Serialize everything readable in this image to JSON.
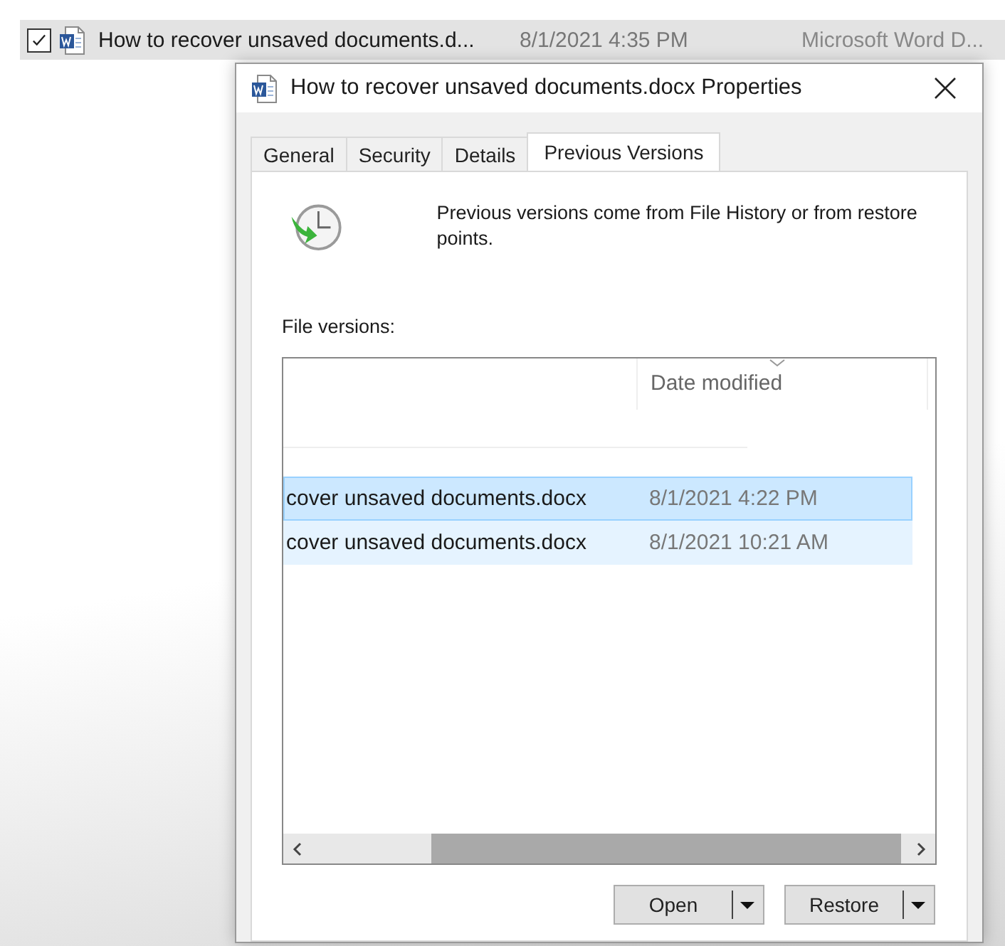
{
  "explorer_row": {
    "checked": true,
    "name": "How to recover unsaved documents.d...",
    "date": "8/1/2021 4:35 PM",
    "type": "Microsoft Word D..."
  },
  "dialog": {
    "title": "How to recover unsaved documents.docx Properties",
    "tabs": [
      {
        "label": "General",
        "selected": false
      },
      {
        "label": "Security",
        "selected": false
      },
      {
        "label": "Details",
        "selected": false
      },
      {
        "label": "Previous Versions",
        "selected": true
      }
    ],
    "description": "Previous versions come from File History or from restore points.",
    "versions_label": "File versions:",
    "columns": [
      {
        "label": "Date modified"
      }
    ],
    "rows": [
      {
        "name": "cover unsaved documents.docx",
        "date": "8/1/2021 4:22 PM",
        "selected": true,
        "hovered": false
      },
      {
        "name": "cover unsaved documents.docx",
        "date": "8/1/2021 10:21 AM",
        "selected": false,
        "hovered": true
      }
    ],
    "buttons": [
      {
        "label": "Open"
      },
      {
        "label": "Restore"
      }
    ]
  }
}
